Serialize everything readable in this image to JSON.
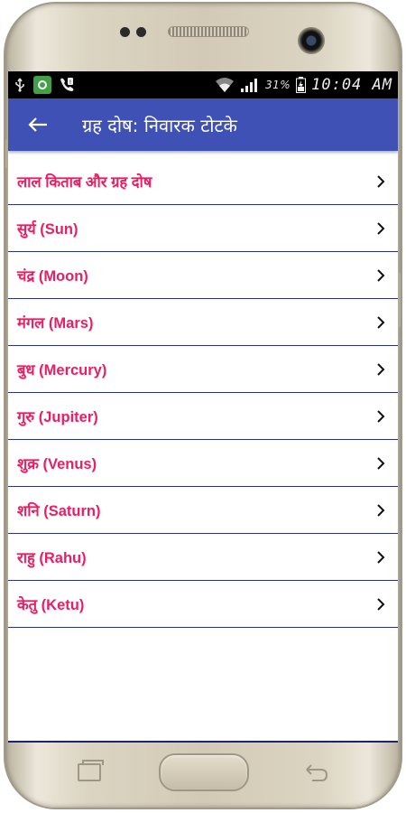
{
  "status_bar": {
    "battery_percent": "31%",
    "time": "10:04 AM",
    "icons": [
      "usb-icon",
      "app-green-icon",
      "phone-chip-icon",
      "wifi-icon",
      "signal-icon",
      "battery-icon"
    ]
  },
  "app_bar": {
    "title": "ग्रह दोष: निवारक टोटके",
    "back_icon": "arrow-back-icon"
  },
  "list": {
    "items": [
      {
        "label": "लाल किताब और ग्रह दोष"
      },
      {
        "label": "सुर्य (Sun)"
      },
      {
        "label": "चंद्र (Moon)"
      },
      {
        "label": "मंगल (Mars)"
      },
      {
        "label": "बुध (Mercury)"
      },
      {
        "label": "गुरु (Jupiter)"
      },
      {
        "label": "शुक्र (Venus)"
      },
      {
        "label": "शनि (Saturn)"
      },
      {
        "label": "राहु (Rahu)"
      },
      {
        "label": "केतु (Ketu)"
      }
    ],
    "chevron_icon": "chevron-right-icon"
  },
  "colors": {
    "app_bar": "#3f51b5",
    "item_text": "#e91e63",
    "divider": "#2a3283"
  }
}
